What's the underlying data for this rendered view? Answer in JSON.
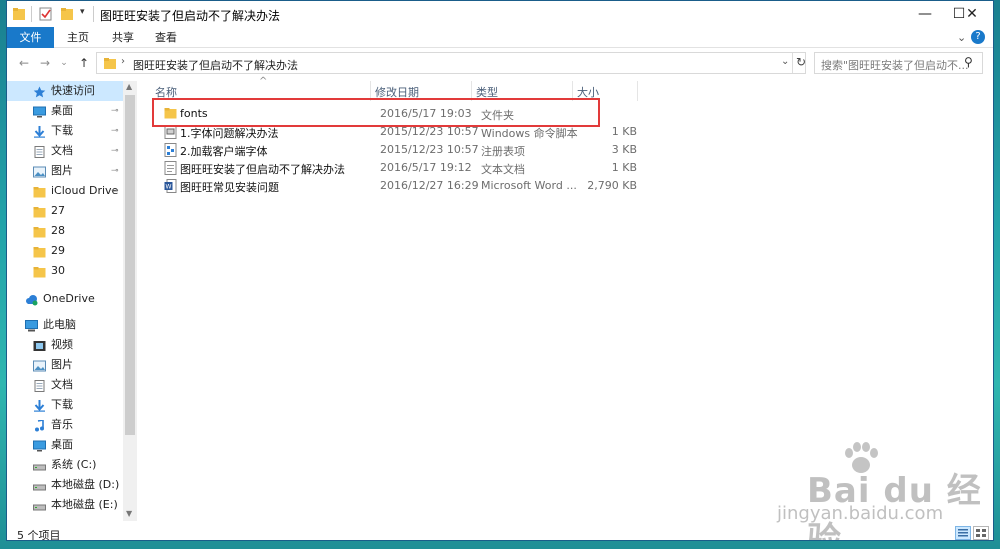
{
  "window": {
    "title": "图旺旺安装了但启动不了解决办法",
    "minimize": "—",
    "maximize": "☐",
    "close": "✕"
  },
  "ribbon": {
    "file": "文件",
    "home": "主页",
    "share": "共享",
    "view": "查看",
    "expand": "⌄",
    "help": "?"
  },
  "address": {
    "path": "图旺旺安装了但启动不了解决办法",
    "search_placeholder": "搜索\"图旺旺安装了但启动不...",
    "back": "←",
    "forward": "→",
    "recent": "⌄",
    "up": "↑",
    "dropdown": "⌄",
    "refresh": "↻",
    "search_icon": "⚲"
  },
  "nav": {
    "items": [
      {
        "label": "快速访问",
        "icon": "star-icon",
        "pinned": false
      },
      {
        "label": "桌面",
        "icon": "desktop-icon",
        "pinned": true
      },
      {
        "label": "下载",
        "icon": "download-icon",
        "pinned": true
      },
      {
        "label": "文档",
        "icon": "document-icon",
        "pinned": true
      },
      {
        "label": "图片",
        "icon": "picture-icon",
        "pinned": true
      },
      {
        "label": "iCloud Drive",
        "icon": "folder-icon",
        "pinned": true
      },
      {
        "label": "27",
        "icon": "folder-icon",
        "pinned": false
      },
      {
        "label": "28",
        "icon": "folder-icon",
        "pinned": false
      },
      {
        "label": "29",
        "icon": "folder-icon",
        "pinned": false
      },
      {
        "label": "30",
        "icon": "folder-icon",
        "pinned": false
      },
      {
        "label": "OneDrive",
        "icon": "cloud-icon",
        "pinned": false
      },
      {
        "label": "此电脑",
        "icon": "computer-icon",
        "pinned": false
      },
      {
        "label": "视频",
        "icon": "video-icon",
        "pinned": false
      },
      {
        "label": "图片",
        "icon": "picture-icon",
        "pinned": false
      },
      {
        "label": "文档",
        "icon": "document-icon",
        "pinned": false
      },
      {
        "label": "下载",
        "icon": "download-icon",
        "pinned": false
      },
      {
        "label": "音乐",
        "icon": "music-icon",
        "pinned": false
      },
      {
        "label": "桌面",
        "icon": "desktop-icon",
        "pinned": false
      },
      {
        "label": "系统 (C:)",
        "icon": "drive-icon",
        "pinned": false
      },
      {
        "label": "本地磁盘 (D:)",
        "icon": "drive-icon",
        "pinned": false
      },
      {
        "label": "本地磁盘 (E:)",
        "icon": "drive-icon",
        "pinned": false
      }
    ],
    "pin_glyph": "📌"
  },
  "columns": {
    "name": "名称",
    "date": "修改日期",
    "type": "类型",
    "size": "大小",
    "sort_glyph": "^"
  },
  "files": [
    {
      "name": "fonts",
      "date": "2016/5/17 19:03",
      "type": "文件夹",
      "size": "",
      "icon": "folder-icon"
    },
    {
      "name": "1.字体问题解决办法",
      "date": "2015/12/23 10:57",
      "type": "Windows 命令脚本",
      "size": "1 KB",
      "icon": "script-icon"
    },
    {
      "name": "2.加载客户端字体",
      "date": "2015/12/23 10:57",
      "type": "注册表项",
      "size": "3 KB",
      "icon": "registry-icon"
    },
    {
      "name": "图旺旺安装了但启动不了解决办法",
      "date": "2016/5/17 19:12",
      "type": "文本文档",
      "size": "1 KB",
      "icon": "text-file-icon"
    },
    {
      "name": "图旺旺常见安装问题",
      "date": "2016/12/27 16:29",
      "type": "Microsoft Word ...",
      "size": "2,790 KB",
      "icon": "word-icon"
    }
  ],
  "status": {
    "count": "5 个项目"
  },
  "watermark": {
    "brand": "Bai du 经验",
    "url": "jingyan.baidu.com"
  },
  "colors": {
    "accent": "#1979ca",
    "highlight_box": "#e23a3a",
    "folder": "#f5c54a",
    "selected_nav": "#cce8ff"
  }
}
